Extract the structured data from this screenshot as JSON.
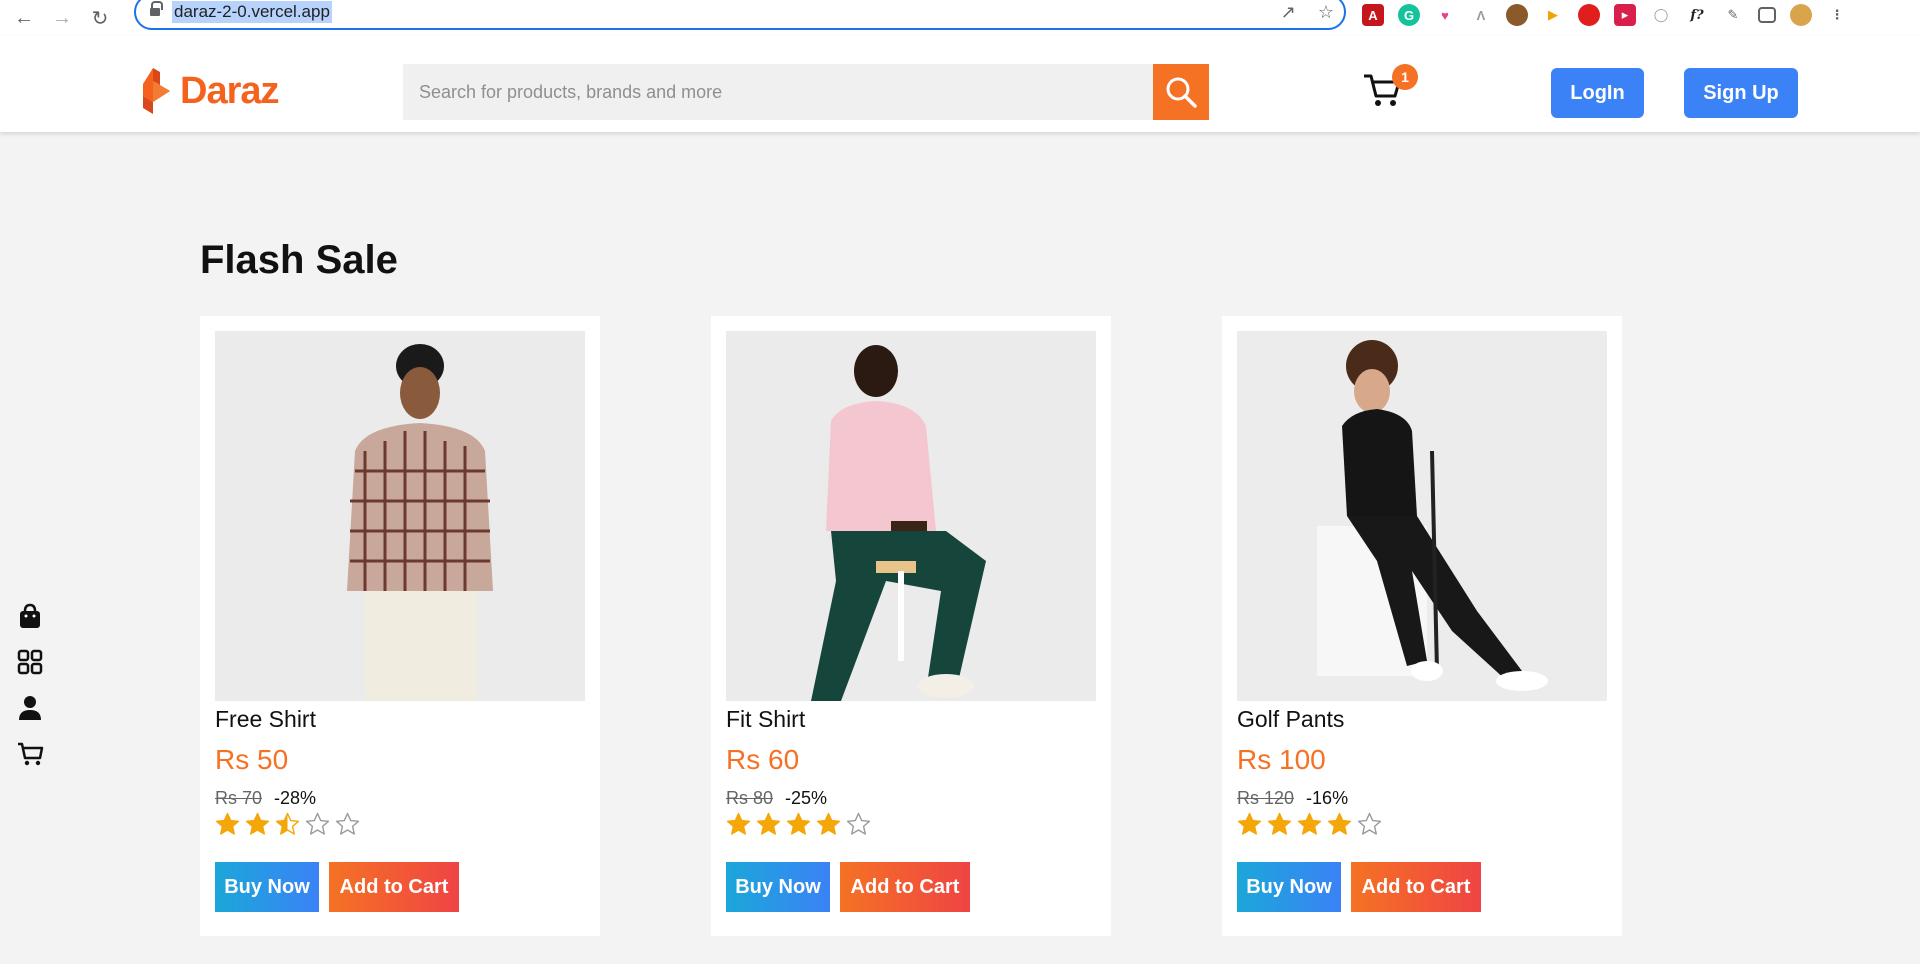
{
  "browser": {
    "url": "daraz-2-0.vercel.app"
  },
  "header": {
    "logo_text": "Daraz",
    "search_placeholder": "Search for products, brands and more",
    "cart_count": "1",
    "login_label": "LogIn",
    "signup_label": "Sign Up"
  },
  "main": {
    "section_title": "Flash Sale",
    "buy_label": "Buy Now",
    "add_to_cart_label": "Add to Cart",
    "products": [
      {
        "name": "Free Shirt",
        "price": "Rs 50",
        "old_price": "Rs 70",
        "discount": "-28%",
        "rating": 2.5
      },
      {
        "name": "Fit Shirt",
        "price": "Rs 60",
        "old_price": "Rs 80",
        "discount": "-25%",
        "rating": 4
      },
      {
        "name": "Golf Pants",
        "price": "Rs 100",
        "old_price": "Rs 120",
        "discount": "-16%",
        "rating": 4
      }
    ]
  },
  "colors": {
    "brand_orange": "#f57224",
    "primary_blue": "#3b82f6",
    "star_gold": "#f5a70a"
  }
}
